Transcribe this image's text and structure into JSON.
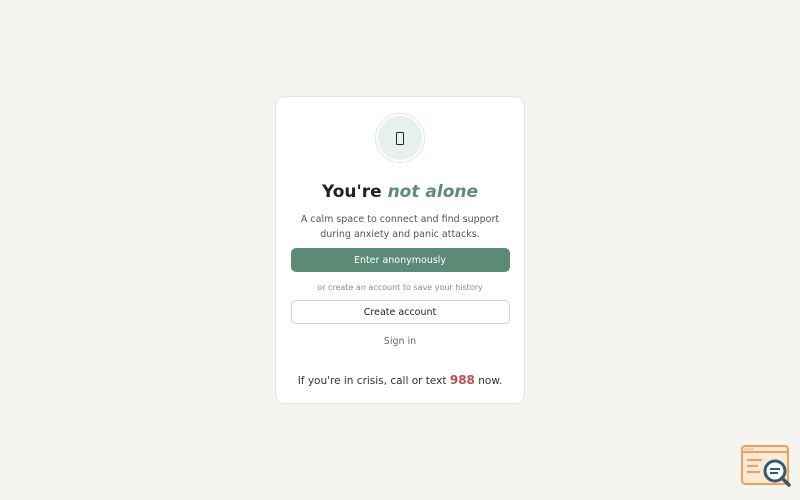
{
  "welcome": {
    "emblem_icon": "document-icon",
    "headline_prefix": "You're",
    "headline_accent": "not alone",
    "tagline": "A calm space to connect and find support during anxiety and panic attacks.",
    "primary_button": "Enter anonymously",
    "account_hint": "or create an account to save your history",
    "secondary_button": "Create account",
    "sign_in_link": "Sign in",
    "crisis_prefix": "If you're in crisis, call or text",
    "crisis_number": "988",
    "crisis_suffix": "now."
  },
  "colors": {
    "background": "#f5f5f0",
    "accent": "#5b8a77",
    "crisis_number": "#c0504d",
    "corner_logo": "#f0a05a"
  },
  "corner_badge": {
    "icon": "search-document-icon"
  }
}
